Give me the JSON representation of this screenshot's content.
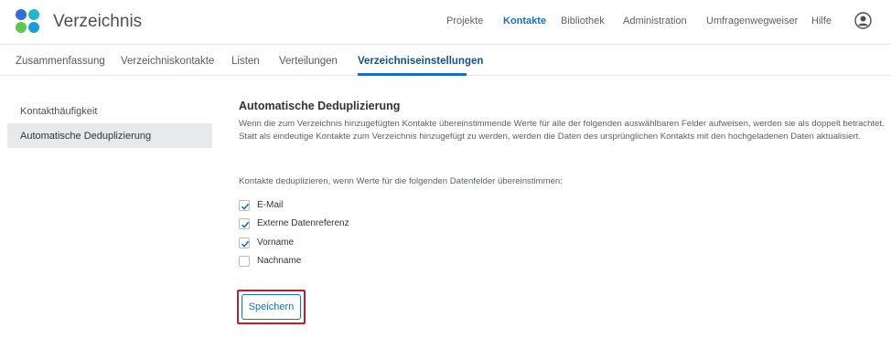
{
  "header": {
    "app_title": "Verzeichnis",
    "nav": [
      {
        "label": "Projekte",
        "active": false
      },
      {
        "label": "Kontakte",
        "active": true
      },
      {
        "label": "Bibliothek",
        "active": false
      },
      {
        "label": "Administration",
        "active": false
      },
      {
        "label": "Umfragenwegweiser",
        "active": false
      },
      {
        "label": "Hilfe",
        "active": false
      }
    ],
    "user_icon": "user-circle-icon"
  },
  "subnav": {
    "tabs": [
      {
        "label": "Zusammenfassung",
        "active": false
      },
      {
        "label": "Verzeichniskontakte",
        "active": false
      },
      {
        "label": "Listen",
        "active": false
      },
      {
        "label": "Verteilungen",
        "active": false
      },
      {
        "label": "Verzeichniseinstellungen",
        "active": true
      }
    ]
  },
  "sidebar": {
    "items": [
      {
        "label": "Kontakthäufigkeit",
        "active": false
      },
      {
        "label": "Automatische Deduplizierung",
        "active": true
      }
    ]
  },
  "main": {
    "title": "Automatische Deduplizierung",
    "description": "Wenn die zum Verzeichnis hinzugefügten Kontakte übereinstimmende Werte für alle der folgenden auswählbaren Felder aufweisen, werden sie als doppelt betrachtet. Statt als eindeutige Kontakte zum Verzeichnis hinzugefügt zu werden, werden die Daten des ursprünglichen Kontakts mit den hochgeladenen Daten aktualisiert.",
    "prompt": "Kontakte deduplizieren, wenn Werte für die folgenden Datenfelder übereinstimmen:",
    "fields": [
      {
        "label": "E-Mail",
        "checked": true
      },
      {
        "label": "Externe Datenreferenz",
        "checked": true
      },
      {
        "label": "Vorname",
        "checked": true
      },
      {
        "label": "Nachname",
        "checked": false
      }
    ],
    "save_label": "Speichern"
  },
  "colors": {
    "accent": "#1b6fbd",
    "highlight_border": "#b3232f"
  }
}
